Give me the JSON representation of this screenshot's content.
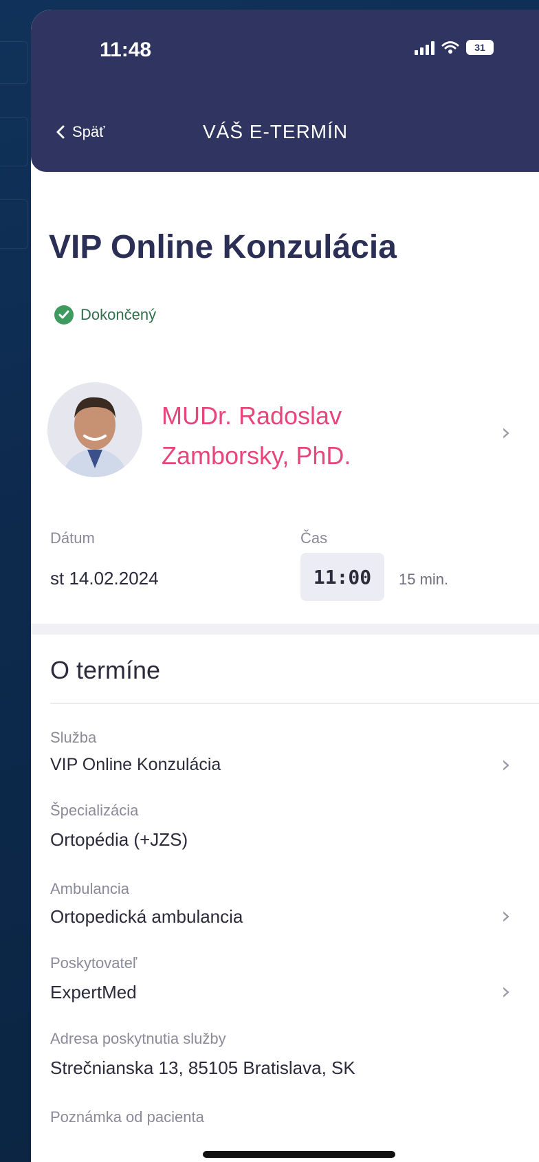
{
  "status_bar": {
    "time": "11:48",
    "battery": "31"
  },
  "nav": {
    "back_label": "Späť",
    "title": "VÁŠ E-TERMÍN"
  },
  "appointment": {
    "title": "VIP Online Konzulácia",
    "status": "Dokončený",
    "doctor_line1": "MUDr. Radoslav",
    "doctor_line2": "Zamborsky, PhD.",
    "date_label": "Dátum",
    "date_value": "st 14.02.2024",
    "time_label": "Čas",
    "time_value": "11:00",
    "duration": "15 min."
  },
  "details": {
    "section_title": "O termíne",
    "service_label": "Služba",
    "service_value": "VIP Online Konzulácia",
    "specialization_label": "Špecializácia",
    "specialization_value": "Ortopédia (+JZS)",
    "ambulance_label": "Ambulancia",
    "ambulance_value": "Ortopedická ambulancia",
    "provider_label": "Poskytovateľ",
    "provider_value": "ExpertMed",
    "address_label": "Adresa poskytnutia služby",
    "address_value": "Strečnianska 13, 85105 Bratislava, SK",
    "note_label": "Poznámka od pacienta"
  },
  "colors": {
    "header": "#2f3460",
    "doctor_name": "#e8457a",
    "status_green": "#3f9a5f"
  },
  "icons": [
    "back-chevron-icon",
    "signal-icon",
    "wifi-icon",
    "battery-icon",
    "check-circle-icon",
    "chevron-right-icon"
  ]
}
